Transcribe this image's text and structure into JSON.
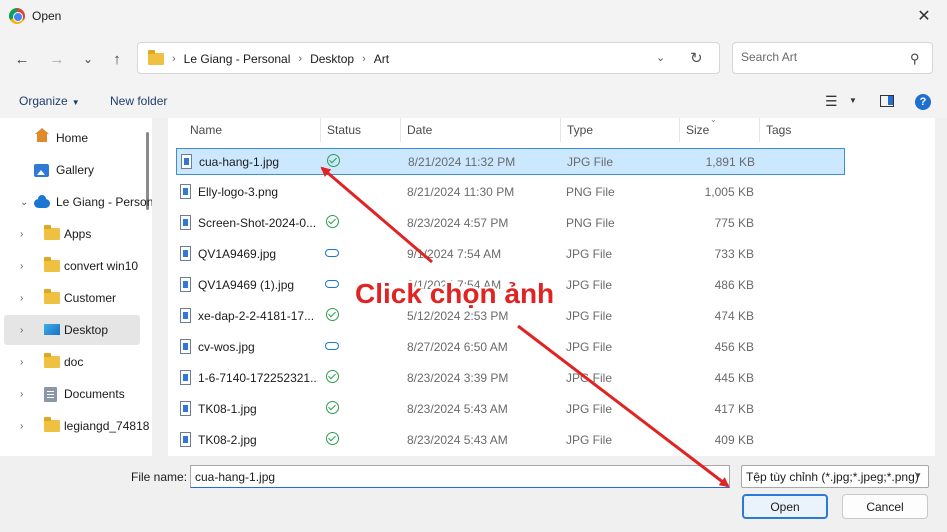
{
  "window": {
    "title": "Open",
    "close_glyph": "✕"
  },
  "nav": {
    "back_glyph": "←",
    "forward_glyph": "→",
    "recent_glyph": "⌄",
    "up_glyph": "↑",
    "refresh_glyph": "↻",
    "dropdown_glyph": "⌄"
  },
  "address": {
    "crumbs": [
      "Le Giang - Personal",
      "Desktop",
      "Art"
    ],
    "sep": "›"
  },
  "search": {
    "placeholder": "Search Art",
    "icon": "search-icon"
  },
  "toolbar": {
    "organize": "Organize",
    "new_folder": "New folder",
    "caret": "▼",
    "view_glyph": "☰",
    "help": "?"
  },
  "sidebar": {
    "items": [
      {
        "label": "Home",
        "icon": "home-icon",
        "chevron": ""
      },
      {
        "label": "Gallery",
        "icon": "gallery-icon",
        "chevron": ""
      },
      {
        "label": "Le Giang - Personal",
        "icon": "onedrive-icon",
        "chevron": "⌄"
      },
      {
        "label": "Apps",
        "icon": "folder-icon",
        "chevron": "›"
      },
      {
        "label": "convert win10",
        "icon": "folder-icon",
        "chevron": "›"
      },
      {
        "label": "Customer",
        "icon": "folder-icon",
        "chevron": "›"
      },
      {
        "label": "Desktop",
        "icon": "desktop-icon",
        "chevron": "›",
        "selected": true
      },
      {
        "label": "doc",
        "icon": "folder-icon",
        "chevron": "›"
      },
      {
        "label": "Documents",
        "icon": "documents-icon",
        "chevron": "›"
      },
      {
        "label": "legiangd_74818",
        "icon": "folder-icon",
        "chevron": "›"
      }
    ]
  },
  "columns": [
    "Name",
    "Status",
    "Date",
    "Type",
    "Size",
    "Tags"
  ],
  "files": [
    {
      "name": "cua-hang-1.jpg",
      "status": "synced",
      "date": "8/21/2024 11:32 PM",
      "type": "JPG File",
      "size": "1,891 KB",
      "selected": true
    },
    {
      "name": "Elly-logo-3.png",
      "status": "",
      "date": "8/21/2024 11:30 PM",
      "type": "PNG File",
      "size": "1,005 KB"
    },
    {
      "name": "Screen-Shot-2024-0...",
      "status": "synced",
      "date": "8/23/2024 4:57 PM",
      "type": "PNG File",
      "size": "775 KB"
    },
    {
      "name": "QV1A9469.jpg",
      "status": "cloud",
      "date": "9/1/2024 7:54 AM",
      "type": "JPG File",
      "size": "733 KB"
    },
    {
      "name": "QV1A9469 (1).jpg",
      "status": "cloud",
      "date": "9/1/2024 7:54 AM",
      "type": "JPG File",
      "size": "486 KB"
    },
    {
      "name": "xe-dap-2-2-4181-17...",
      "status": "synced",
      "date": "5/12/2024 2:53 PM",
      "type": "JPG File",
      "size": "474 KB"
    },
    {
      "name": "cv-wos.jpg",
      "status": "cloud",
      "date": "8/27/2024 6:50 AM",
      "type": "JPG File",
      "size": "456 KB"
    },
    {
      "name": "1-6-7140-172252321...",
      "status": "synced",
      "date": "8/23/2024 3:39 PM",
      "type": "JPG File",
      "size": "445 KB"
    },
    {
      "name": "TK08-1.jpg",
      "status": "synced",
      "date": "8/23/2024 5:43 AM",
      "type": "JPG File",
      "size": "417 KB"
    },
    {
      "name": "TK08-2.jpg",
      "status": "synced",
      "date": "8/23/2024 5:43 AM",
      "type": "JPG File",
      "size": "409 KB"
    }
  ],
  "bottom": {
    "file_name_label": "File name:",
    "file_name_value": "cua-hang-1.jpg",
    "file_type": "Tệp tùy chỉnh (*.jpg;*.jpeg;*.png)",
    "open": "Open",
    "cancel": "Cancel"
  },
  "annotation": {
    "text": "Click chọn ảnh",
    "color": "#e02424"
  },
  "colors": {
    "accent": "#1f6fd0",
    "selection": "#cce8ff",
    "synced": "#2a9d4a",
    "cloud": "#1976d2"
  }
}
